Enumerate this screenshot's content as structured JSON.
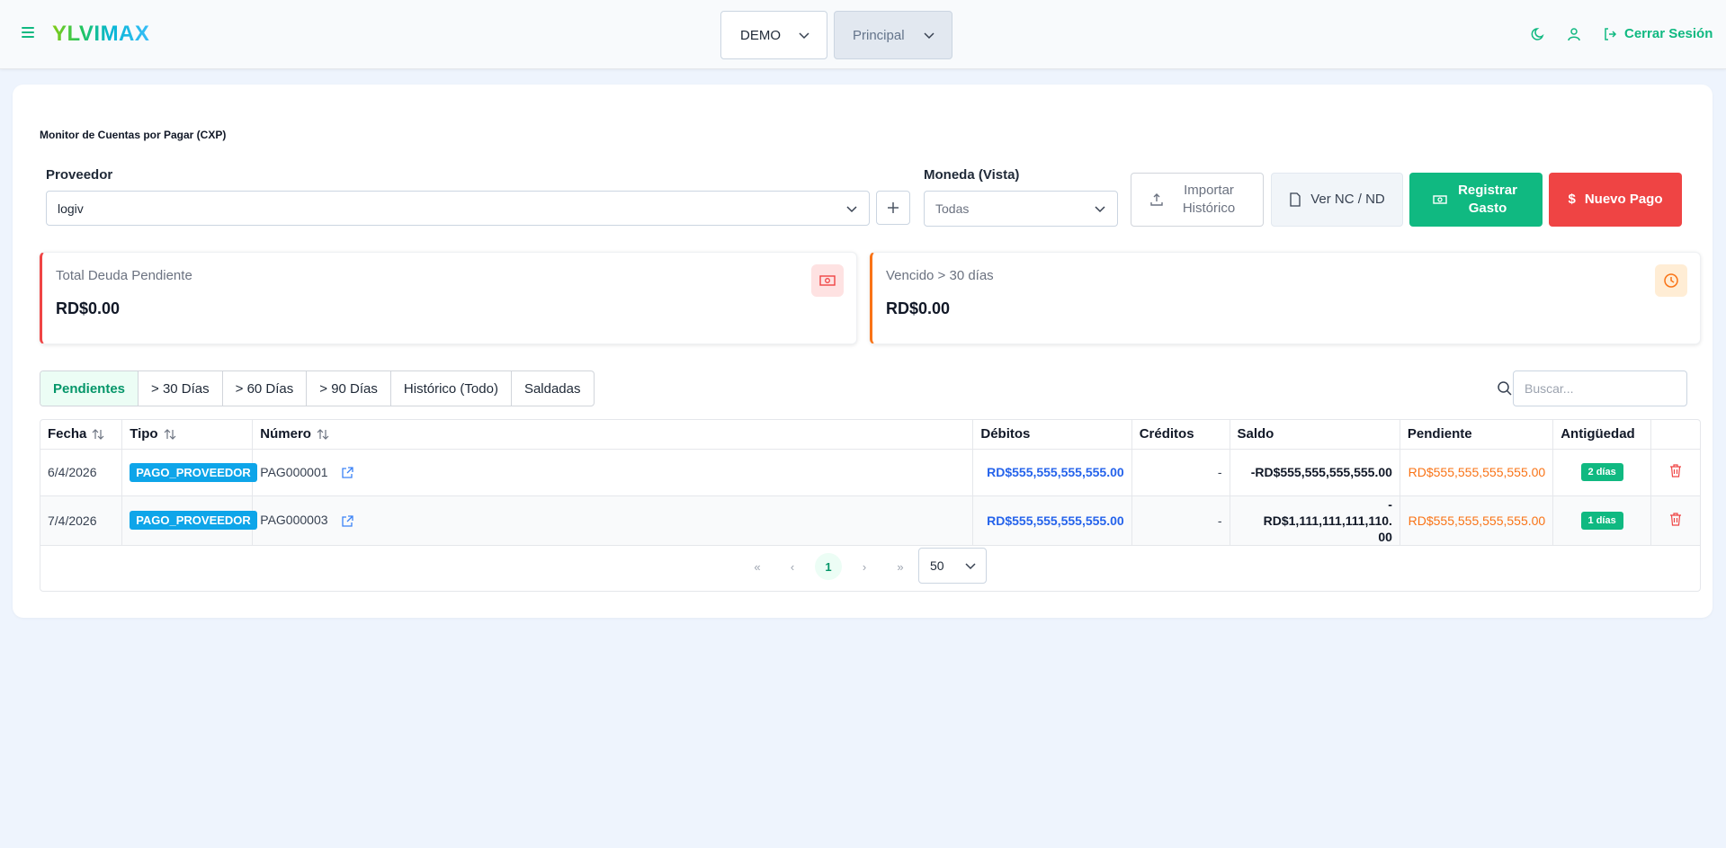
{
  "app": {
    "logo": "YLVIMAX"
  },
  "header": {
    "company_select": "DEMO",
    "branch_select": "Principal",
    "logout_label": "Cerrar Sesión"
  },
  "page": {
    "title": "Monitor de Cuentas por Pagar (CXP)"
  },
  "filters": {
    "proveedor_label": "Proveedor",
    "proveedor_value": "logiv",
    "moneda_label": "Moneda (Vista)",
    "moneda_value": "Todas"
  },
  "actions": {
    "import_label": "Importar Histórico",
    "nc_label": "Ver NC / ND",
    "gasto_label": "Registrar Gasto",
    "pago_label": "Nuevo Pago"
  },
  "kpis": {
    "total_label": "Total Deuda Pendiente",
    "total_value": "RD$0.00",
    "vencido_label": "Vencido > 30 días",
    "vencido_value": "RD$0.00"
  },
  "tabs": [
    "Pendientes",
    "> 30 Días",
    "> 60 Días",
    "> 90 Días",
    "Histórico (Todo)",
    "Saldadas"
  ],
  "search": {
    "placeholder": "Buscar..."
  },
  "table": {
    "columns": [
      "Fecha",
      "Tipo",
      "Número",
      "Débitos",
      "Créditos",
      "Saldo",
      "Pendiente",
      "Antigüedad"
    ],
    "rows": [
      {
        "fecha": "6/4/2026",
        "tipo": "PAGO_PROVEEDOR",
        "numero": "PAG000001",
        "debitos": "RD$555,555,555,555.00",
        "creditos": "-",
        "saldo": "-RD$555,555,555,555.00",
        "pendiente": "RD$555,555,555,555.00",
        "antiguedad": "2 días"
      },
      {
        "fecha": "7/4/2026",
        "tipo": "PAGO_PROVEEDOR",
        "numero": "PAG000003",
        "debitos": "RD$555,555,555,555.00",
        "creditos": "-",
        "saldo": "-RD$1,111,111,111,110.00",
        "pendiente": "RD$555,555,555,555.00",
        "antiguedad": "1 días"
      }
    ]
  },
  "pagination": {
    "current_page": "1",
    "per_page": "50"
  },
  "colors": {
    "accent": "#10b981",
    "danger": "#ef4444",
    "warning": "#f97316",
    "link": "#2563eb",
    "tipo_badge": "#0ea5e9"
  }
}
